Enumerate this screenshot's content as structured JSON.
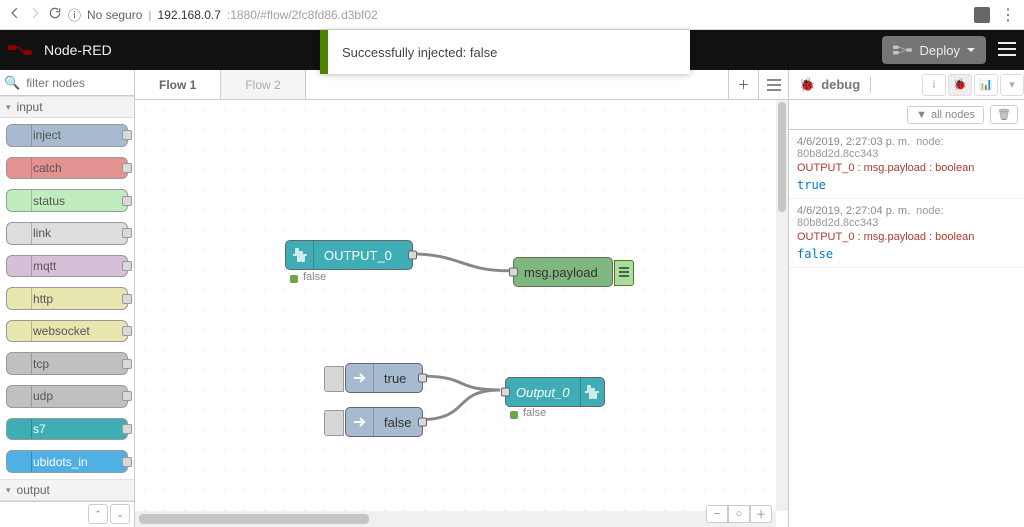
{
  "browser": {
    "insecure_label": "No seguro",
    "url_host": "192.168.0.7",
    "url_rest": ":1880/#flow/2fc8fd86.d3bf02"
  },
  "header": {
    "brand": "Node-RED",
    "deploy_label": "Deploy",
    "toast": "Successfully injected: false"
  },
  "palette": {
    "search_placeholder": "filter nodes",
    "sections": {
      "input": "input",
      "output": "output"
    },
    "items": [
      {
        "label": "inject",
        "bg": "#a6bbcf"
      },
      {
        "label": "catch",
        "bg": "#e49191"
      },
      {
        "label": "status",
        "bg": "#c0edc0"
      },
      {
        "label": "link",
        "bg": "#dddddd"
      },
      {
        "label": "mqtt",
        "bg": "#d8bfd8"
      },
      {
        "label": "http",
        "bg": "#e7e6af"
      },
      {
        "label": "websocket",
        "bg": "#e7e6af"
      },
      {
        "label": "tcp",
        "bg": "#c0c0c0"
      },
      {
        "label": "udp",
        "bg": "#c0c0c0"
      },
      {
        "label": "s7",
        "bg": "#3fadb5"
      },
      {
        "label": "ubidots_in",
        "bg": "#4fb0e6"
      }
    ]
  },
  "tabs": {
    "active": "Flow 1",
    "other": "Flow 2"
  },
  "flow": {
    "s7in": {
      "label": "OUTPUT_0",
      "status": "false"
    },
    "debug": {
      "label": "msg.payload"
    },
    "injT": {
      "label": "true"
    },
    "injF": {
      "label": "false"
    },
    "s7out": {
      "label": "Output_0",
      "status": "false"
    }
  },
  "debug_panel": {
    "title": "debug",
    "filter_label": "all nodes",
    "messages": [
      {
        "time": "4/6/2019, 2:27:03 p. m.",
        "node": "node: 80b8d2d.8cc343",
        "source": "OUTPUT_0 : msg.payload : boolean",
        "payload": "true"
      },
      {
        "time": "4/6/2019, 2:27:04 p. m.",
        "node": "node: 80b8d2d.8cc343",
        "source": "OUTPUT_0 : msg.payload : boolean",
        "payload": "false"
      }
    ]
  }
}
